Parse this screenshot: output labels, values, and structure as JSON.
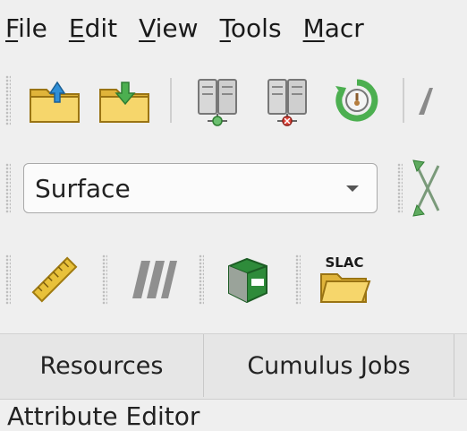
{
  "menubar": {
    "items": [
      {
        "accel": "F",
        "rest": "ile"
      },
      {
        "accel": "E",
        "rest": "dit"
      },
      {
        "accel": "V",
        "rest": "iew"
      },
      {
        "accel": "T",
        "rest": "ools"
      },
      {
        "accel": "M",
        "rest": "acr"
      }
    ]
  },
  "toolbar_view": {
    "representation_value": "Surface"
  },
  "tabs": [
    {
      "label": "Resources"
    },
    {
      "label": "Cumulus Jobs"
    }
  ],
  "panel": {
    "title": "Attribute Editor"
  },
  "icons": {
    "slac_text": "SLAC"
  }
}
